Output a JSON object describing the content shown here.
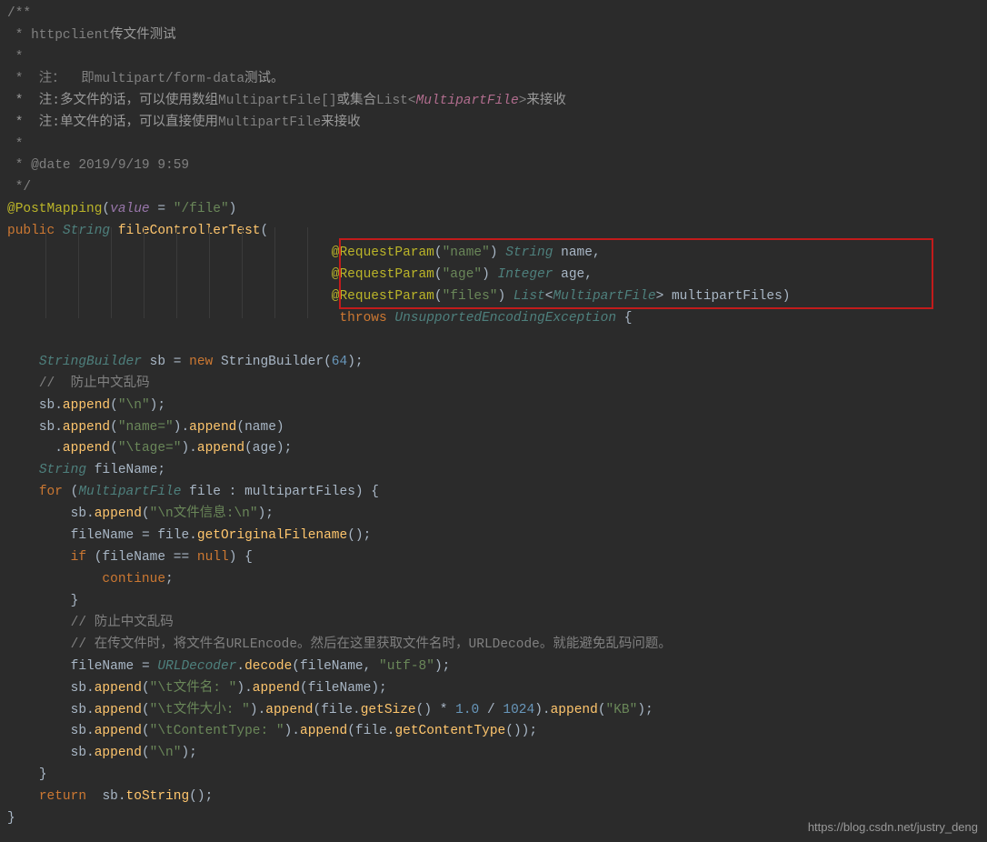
{
  "watermark": "https://blog.csdn.net/justry_deng",
  "comment": {
    "l1": "/**",
    "l2_a": " * httpclient",
    "l2_b": "传文件测试",
    "l3": " *",
    "l4_a": " *  注：  即multipart/form-data",
    "l4_b": "测试。",
    "l5_a": " *  注:多文件的话，可以使用数组",
    "l5_b": "MultipartFile[]",
    "l5_c": "或集合",
    "l5_d": "List",
    "l5_e": "<",
    "l5_f": "MultipartFile",
    "l5_g": ">",
    "l5_h": "来接收",
    "l6_a": " *  注:单文件的话，可以直接使用",
    "l6_b": "MultipartFile",
    "l6_c": "来接收",
    "l7": " *",
    "l8": " * @date 2019/9/19 9:59",
    "l9": " */"
  },
  "code": {
    "ann_post": "@PostMapping",
    "value_kw": "value",
    "file_path": "\"/file\"",
    "public": "public",
    "string": "String",
    "methodName": "fileControllerTest",
    "req_param": "@RequestParam",
    "name_str": "\"name\"",
    "age_str": "\"age\"",
    "files_str": "\"files\"",
    "integer": "Integer",
    "list": "List",
    "multipartFile": "MultipartFile",
    "name_var": "name",
    "age_var": "age",
    "mpFiles_var": "multipartFiles",
    "throws": "throws",
    "uee": "UnsupportedEncodingException",
    "sbType": "StringBuilder",
    "sb": "sb",
    "new": "new",
    "n64": "64",
    "cmt_prevent": "//  防止中文乱码",
    "cmt_prevent2": "// 防止中文乱码",
    "cmt_encode": "// 在传文件时，将文件名URLEncode。然后在这里获取文件名时，URLDecode。就能避免乱码问题。",
    "append": "append",
    "nl": "\"\\n\"",
    "nameeq": "\"name=\"",
    "tage": "\"\\tage=\"",
    "fileName": "fileName",
    "for": "for",
    "file": "file",
    "fileinfo_a": "\"\\n",
    "fileinfo_b": "文件信息:",
    "fileinfo_c": "\\n\"",
    "getOrig": "getOriginalFilename",
    "if": "if",
    "null": "null",
    "continue": "continue",
    "urlDecoder": "URLDecoder",
    "decode": "decode",
    "utf8": "\"utf-8\"",
    "tfname_a": "\"\\t",
    "tfname_b": "文件名:",
    "tfname_c": " \"",
    "tfsize_a": "\"\\t",
    "tfsize_b": "文件大小:",
    "tfsize_c": " \"",
    "getSize": "getSize",
    "n1_0": "1.0",
    "n1024": "1024",
    "kb": "\"KB\"",
    "tct": "\"\\tContentType: \"",
    "getCT": "getContentType",
    "return": "return",
    "toString": "toString"
  }
}
